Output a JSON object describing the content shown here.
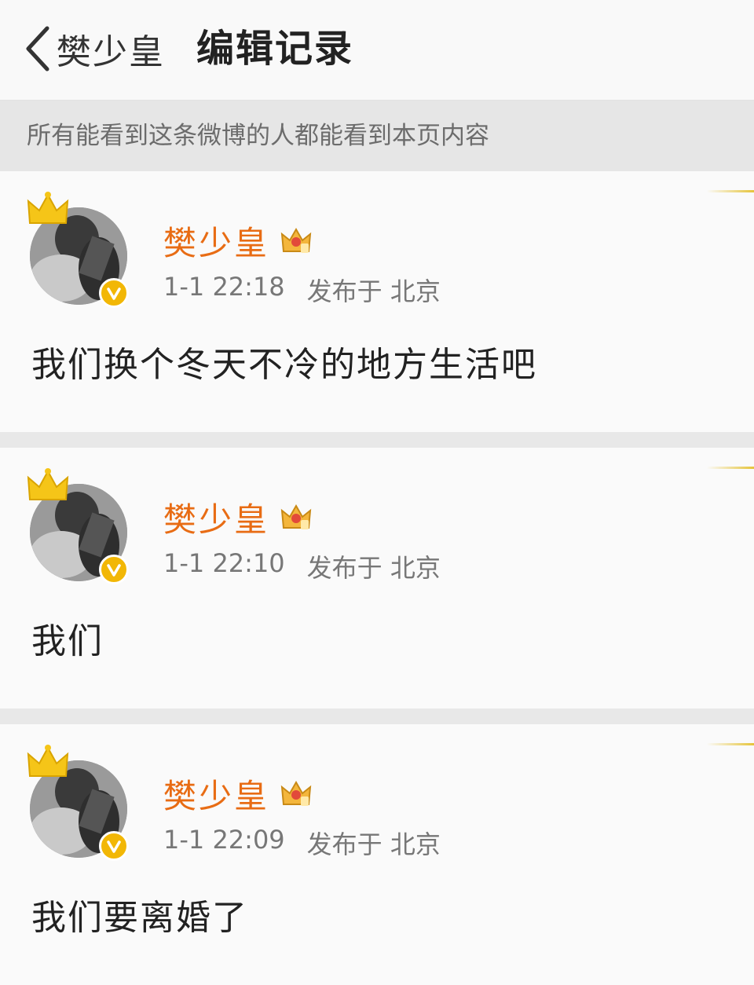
{
  "header": {
    "back_label": "樊少皇",
    "title": "编辑记录"
  },
  "notice": "所有能看到这条微博的人都能看到本页内容",
  "posts": [
    {
      "author": "樊少皇",
      "time": "1-1 22:18",
      "location": "发布于 北京",
      "content": "我们换个冬天不冷的地方生活吧"
    },
    {
      "author": "樊少皇",
      "time": "1-1 22:10",
      "location": "发布于 北京",
      "content": "我们"
    },
    {
      "author": "樊少皇",
      "time": "1-1 22:09",
      "location": "发布于 北京",
      "content": "我们要离婚了"
    }
  ],
  "colors": {
    "name": "#e86c14",
    "verified_badge": "#f2b705",
    "crown": "#f5c518"
  },
  "icons": {
    "back": "chevron-left-icon",
    "crown": "crown-icon",
    "verified": "verified-v-icon",
    "member": "member-crown-icon"
  }
}
